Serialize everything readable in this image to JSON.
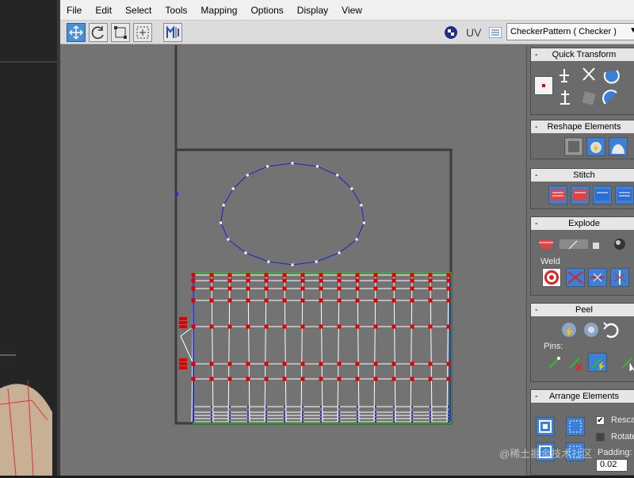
{
  "menu": [
    "File",
    "Edit",
    "Select",
    "Tools",
    "Mapping",
    "Options",
    "Display",
    "View"
  ],
  "toolbar": {
    "uv_label": "UV",
    "checker_value": "CheckerPattern  ( Checker )"
  },
  "panel": {
    "quick_transform": "Quick Transform",
    "reshape": "Reshape Elements",
    "stitch": "Stitch",
    "explode": "Explode",
    "weld": "Weld",
    "peel": "Peel",
    "pins": "Pins:",
    "arrange": "Arrange Elements",
    "rescale": "Rescale",
    "rotate": "Rotate",
    "padding_label": "Padding:",
    "padding_value": "0.02",
    "minus": "-"
  },
  "watermark": "@稀土掘金技术社区",
  "colors": {
    "uv_edge": "#1f1fd6",
    "uv_vertex": "#e00000",
    "uv_line": "#ffffff",
    "selection_green": "#22bb22",
    "canvas_bg": "#737373"
  }
}
